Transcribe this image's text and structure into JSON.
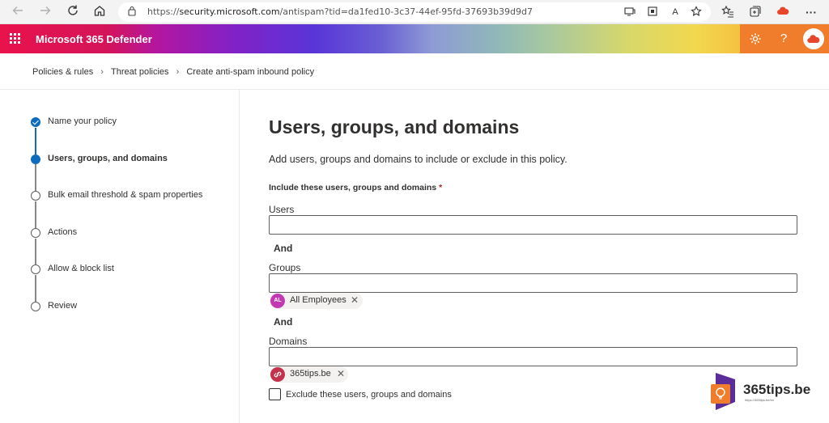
{
  "browser": {
    "url_prefix": "https://",
    "url_host": "security.microsoft.com",
    "url_path": "/antispam?tid=da1fed10-3c37-44ef-95fd-37693b39d9d7",
    "icons": [
      "back-arrow-icon",
      "forward-arrow-icon",
      "refresh-icon",
      "home-icon",
      "lock-icon",
      "reader-view-icon",
      "apps-grid-icon",
      "read-aloud-icon",
      "favorite-star-icon",
      "favorites-list-icon",
      "collections-icon",
      "cloud-extension-icon",
      "more-icon"
    ],
    "read_aloud_glyph": "A"
  },
  "app": {
    "title": "Microsoft 365 Defender",
    "help_glyph": "?",
    "accent": "#0f6cbd",
    "header_right_bg": "#f07d2b"
  },
  "breadcrumb": {
    "items": [
      "Policies & rules",
      "Threat policies",
      "Create anti-spam inbound policy"
    ],
    "separator": "›"
  },
  "steps": [
    {
      "label": "Name your policy",
      "state": "done"
    },
    {
      "label": "Users, groups, and domains",
      "state": "current"
    },
    {
      "label": "Bulk email threshold & spam properties",
      "state": "pending"
    },
    {
      "label": "Actions",
      "state": "pending"
    },
    {
      "label": "Allow & block list",
      "state": "pending"
    },
    {
      "label": "Review",
      "state": "pending"
    }
  ],
  "main": {
    "title": "Users, groups, and domains",
    "subtitle": "Add users, groups and domains to include or exclude in this policy.",
    "section_label": "Include these users, groups and domains",
    "required_mark": "*",
    "users": {
      "label": "Users",
      "value": ""
    },
    "and_1": "And",
    "groups": {
      "label": "Groups",
      "value": "",
      "chips": [
        {
          "initials": "AL",
          "name": "All Employees",
          "color": "#c239b3"
        }
      ]
    },
    "and_2": "And",
    "domains": {
      "label": "Domains",
      "value": "",
      "chips": [
        {
          "name": "365tips.be",
          "color": "#c4314b"
        }
      ]
    },
    "exclude_label": "Exclude these users, groups and domains",
    "exclude_checked": false,
    "chip_remove_glyph": "✕"
  },
  "watermark": {
    "text": "365tips.be",
    "small": "https://365tips.be/en"
  }
}
